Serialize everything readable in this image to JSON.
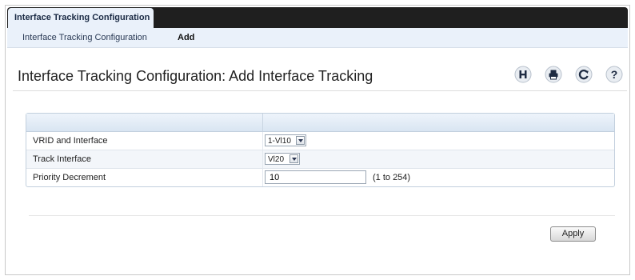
{
  "tabs": {
    "active_label": "Interface Tracking Configuration"
  },
  "subnav": {
    "items": [
      {
        "label": "Interface Tracking Configuration"
      },
      {
        "label": "Add"
      }
    ]
  },
  "page": {
    "title": "Interface Tracking Configuration: Add Interface Tracking"
  },
  "toolbar": {
    "icons": [
      "save-icon",
      "print-icon",
      "refresh-icon",
      "help-icon"
    ],
    "accent": "#2d6fb5"
  },
  "form": {
    "rows": [
      {
        "label": "VRID and Interface",
        "value": "1-Vl10"
      },
      {
        "label": "Track Interface",
        "value": "Vl20"
      },
      {
        "label": "Priority Decrement",
        "value": "10",
        "hint": "(1 to 254)"
      }
    ]
  },
  "actions": {
    "apply_label": "Apply"
  }
}
